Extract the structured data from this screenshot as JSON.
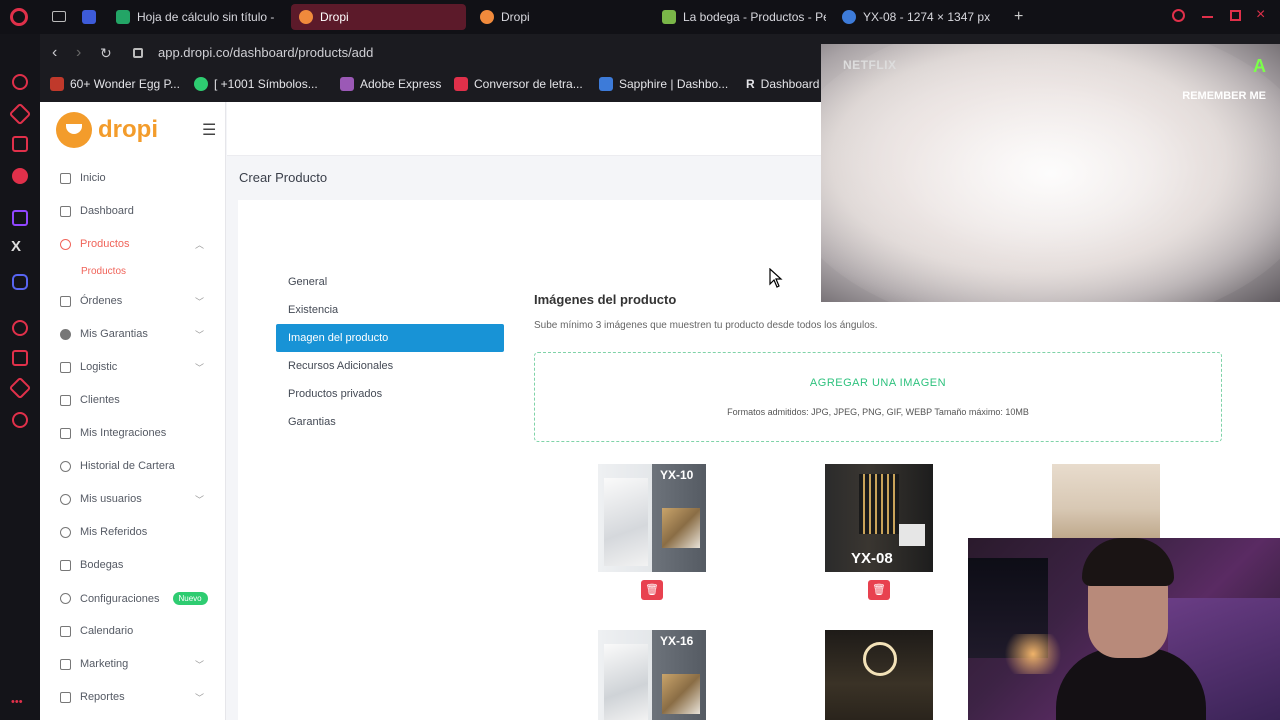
{
  "browser": {
    "tabs": [
      {
        "label": "Hoja de cálculo sin título -",
        "color": "#23a566"
      },
      {
        "label": "Dropi",
        "color": "#f08a3c",
        "active": true
      },
      {
        "label": "Dropi",
        "color": "#f08a3c"
      },
      {
        "label": "La bodega - Productos - Pe",
        "color": "#7ab648"
      },
      {
        "label": "YX-08 - 1274 × 1347 px",
        "color": "#3d7bd9"
      }
    ],
    "url": "app.dropi.co/dashboard/products/add",
    "bookmarks": [
      "60+ Wonder Egg P...",
      "[ +1001 Símbolos...",
      "Adobe Express",
      "Conversor de letra...",
      "Sapphire | Dashbo...",
      "Dashboard"
    ]
  },
  "sidebar": {
    "logo": "dropi",
    "items": [
      {
        "label": "Inicio"
      },
      {
        "label": "Dashboard"
      },
      {
        "label": "Productos",
        "active": true
      },
      {
        "label": "Órdenes"
      },
      {
        "label": "Mis Garantias"
      },
      {
        "label": "Logistic"
      },
      {
        "label": "Clientes"
      },
      {
        "label": "Mis Integraciones"
      },
      {
        "label": "Historial de Cartera"
      },
      {
        "label": "Mis usuarios"
      },
      {
        "label": "Mis Referidos"
      },
      {
        "label": "Bodegas"
      },
      {
        "label": "Configuraciones"
      },
      {
        "label": "Calendario"
      },
      {
        "label": "Marketing"
      },
      {
        "label": "Reportes"
      }
    ],
    "sub_item": "Productos",
    "new_badge": "Nuevo"
  },
  "main": {
    "page_title": "Crear Producto",
    "tabs": [
      "General",
      "Existencia",
      "Imagen del producto",
      "Recursos Adicionales",
      "Productos privados",
      "Garantias"
    ],
    "section_title": "Imágenes del producto",
    "section_sub": "Sube mínimo 3 imágenes que muestren tu producto desde todos los ángulos.",
    "dropzone_title": "AGREGAR UNA IMAGEN",
    "dropzone_sub": "Formatos admitidos: JPG, JPEG, PNG, GIF, WEBP Tamaño máximo: 10MB",
    "thumbnails": [
      {
        "label": "YX-10"
      },
      {
        "label": "YX-08"
      },
      {
        "label": ""
      },
      {
        "label": "YX-16"
      },
      {
        "label": ""
      }
    ]
  },
  "overlay": {
    "netflix_logo": "NETFLIX",
    "show_title": "REMEMBER ME",
    "rating": "A"
  }
}
